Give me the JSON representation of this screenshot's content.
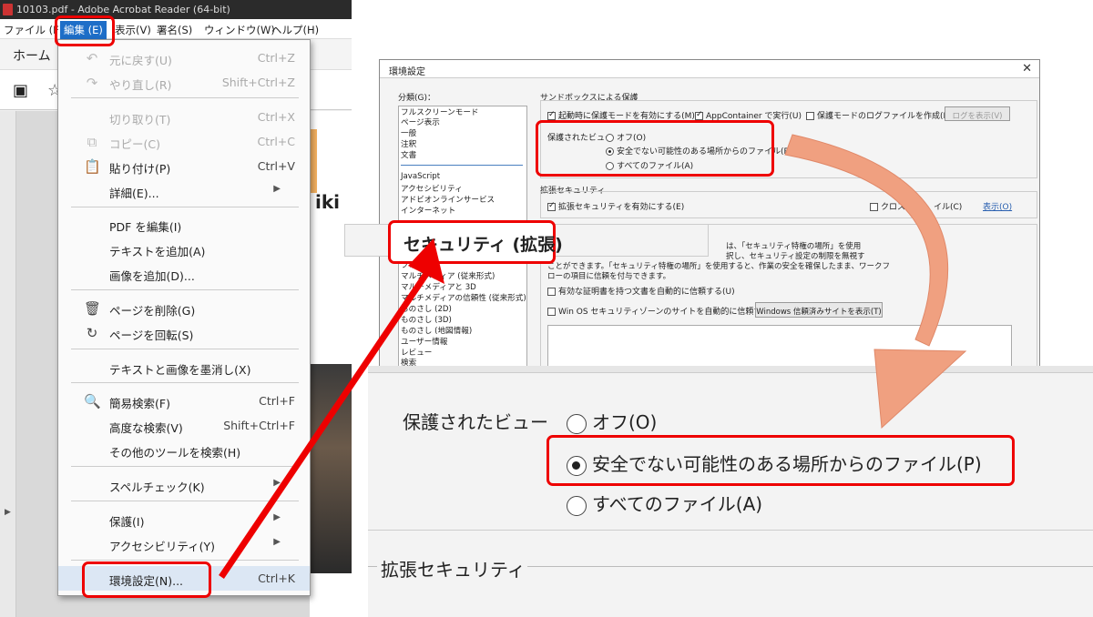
{
  "window": {
    "title": "10103.pdf - Adobe Acrobat Reader (64-bit)"
  },
  "menubar": [
    "ファイル (F)",
    "編集 (E)",
    "表示(V)",
    "署名(S)",
    "ウィンドウ(W)",
    "ヘルプ(H)"
  ],
  "tab": {
    "home": "ホーム"
  },
  "doc": {
    "fragment": "iki"
  },
  "edit_menu": [
    {
      "label": "元に戻す(U)",
      "shortcut": "Ctrl+Z",
      "disabled": true,
      "icon": "undo-icon"
    },
    {
      "label": "やり直し(R)",
      "shortcut": "Shift+Ctrl+Z",
      "disabled": true,
      "icon": "redo-icon"
    },
    {
      "label": "切り取り(T)",
      "shortcut": "Ctrl+X",
      "disabled": true
    },
    {
      "label": "コピー(C)",
      "shortcut": "Ctrl+C",
      "disabled": true,
      "icon": "copy-icon"
    },
    {
      "label": "貼り付け(P)",
      "shortcut": "Ctrl+V",
      "disabled": false,
      "icon": "clipboard-icon"
    },
    {
      "label": "詳細(E)...",
      "shortcut": "",
      "disabled": false,
      "submenu": true
    },
    {
      "label": "PDF を編集(I)",
      "shortcut": "",
      "disabled": false
    },
    {
      "label": "テキストを追加(A)",
      "shortcut": "",
      "disabled": false
    },
    {
      "label": "画像を追加(D)...",
      "shortcut": "",
      "disabled": false
    },
    {
      "label": "ページを削除(G)",
      "shortcut": "",
      "disabled": false,
      "icon": "trash-icon"
    },
    {
      "label": "ページを回転(S)",
      "shortcut": "",
      "disabled": false,
      "icon": "rotate-icon"
    },
    {
      "label": "テキストと画像を墨消し(X)",
      "shortcut": "",
      "disabled": false
    },
    {
      "label": "簡易検索(F)",
      "shortcut": "Ctrl+F",
      "disabled": false,
      "icon": "search-icon"
    },
    {
      "label": "高度な検索(V)",
      "shortcut": "Shift+Ctrl+F",
      "disabled": false
    },
    {
      "label": "その他のツールを検索(H)",
      "shortcut": "",
      "disabled": false
    },
    {
      "label": "スペルチェック(K)",
      "shortcut": "",
      "disabled": false,
      "submenu": true
    },
    {
      "label": "保護(I)",
      "shortcut": "",
      "disabled": false,
      "submenu": true
    },
    {
      "label": "アクセシビリティ(Y)",
      "shortcut": "",
      "disabled": false,
      "submenu": true
    },
    {
      "label": "環境設定(N)...",
      "shortcut": "Ctrl+K",
      "disabled": false
    }
  ],
  "dialog": {
    "title": "環境設定",
    "category_label": "分類(G)：",
    "categories": [
      "フルスクリーンモード",
      "ページ表示",
      "一般",
      "注釈",
      "文書",
      "JavaScript",
      "アクセシビリティ",
      "アドビオンラインサービス",
      "インターネット",
      "フォーム",
      "マルチメディア (従来形式)",
      "マルチメディアと 3D",
      "マルチメディアの信頼性 (従来形式)",
      "ものさし (2D)",
      "ものさし (3D)",
      "ものさし (地図情報)",
      "ユーザー情報",
      "レビュー",
      "検索"
    ],
    "sandbox_group": "サンドボックスによる保護",
    "sandbox_check1": "起動時に保護モードを有効にする(M)",
    "sandbox_check2": "AppContainer で実行(U)",
    "sandbox_check3": "保護モードのログファイルを作成(L)",
    "view_log_button": "ログを表示(V)",
    "protected_view_label": "保護されたビュー",
    "pv_off": "オフ(O)",
    "pv_unsafe": "安全でない可能性のある場所からのファイル(P)",
    "pv_all": "すべてのファイル(A)",
    "enhanced_group": "拡張セキュリティ",
    "enhanced_check": "拡張セキュリティを有効にする(E)",
    "cross_domain": "クロスドメ",
    "cross_domain_tail": "イル(C)",
    "show_button": "表示(O)",
    "privileged_text1": "は、「セキュリティ特権の場所」を使用",
    "privileged_text2": "択し、セキュリティ設定の制限を無視す",
    "privileged_text3": "ことができます。「セキュリティ特権の場所」を使用すると、作業の安全を確保したまま、ワークフ",
    "privileged_text4": "ローの項目に信頼を付与できます。",
    "cert_check": "有効な証明書を持つ文書を自動的に信頼する(U)",
    "winos_check": "Win OS セキュリティゾーンのサイトを自動的に信頼する(S)",
    "winos_button": "Windows 信頼済みサイトを表示(T)"
  },
  "callout": {
    "security_enhanced": "セキュリティ (拡張)"
  },
  "zoom": {
    "protected_view_label": "保護されたビュー",
    "off": "オフ(O)",
    "unsafe": "安全でない可能性のある場所からのファイル(P)",
    "all": "すべてのファイル(A)",
    "enhanced": "拡張セキュリティ"
  },
  "colors": {
    "highlight": "#e00000",
    "menu_selected": "#1e6ec8",
    "arrow_orange": "#f0a080"
  }
}
